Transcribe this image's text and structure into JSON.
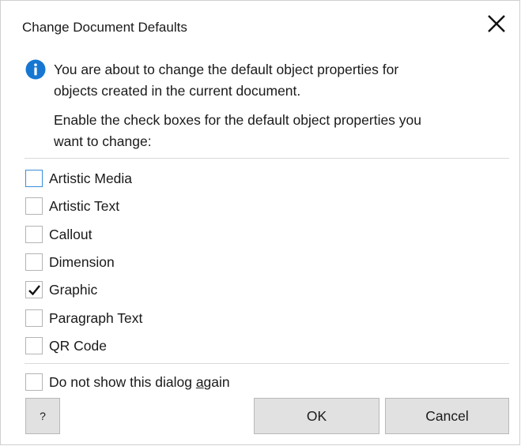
{
  "dialog": {
    "title": "Change Document Defaults",
    "close_icon": "close-x-icon"
  },
  "message": {
    "icon": "info-icon",
    "icon_color": "#1677d2",
    "line1": "You are about to change the default object properties for",
    "line2": "objects created in the current document.",
    "line3": "Enable the check boxes for the default object properties you",
    "line4": "want to change:"
  },
  "options": [
    {
      "label": "Artistic Media",
      "checked": false,
      "focused": true
    },
    {
      "label": "Artistic Text",
      "checked": false,
      "focused": false
    },
    {
      "label": "Callout",
      "checked": false,
      "focused": false
    },
    {
      "label": "Dimension",
      "checked": false,
      "focused": false
    },
    {
      "label": "Graphic",
      "checked": true,
      "focused": false
    },
    {
      "label": "Paragraph Text",
      "checked": false,
      "focused": false
    },
    {
      "label": "QR Code",
      "checked": false,
      "focused": false
    }
  ],
  "dont_show": {
    "label_before": "Do not show this dialog ",
    "label_underlined": "a",
    "label_after": "gain",
    "checked": false
  },
  "buttons": {
    "help_label": "?",
    "ok_label": "OK",
    "cancel_label": "Cancel"
  }
}
